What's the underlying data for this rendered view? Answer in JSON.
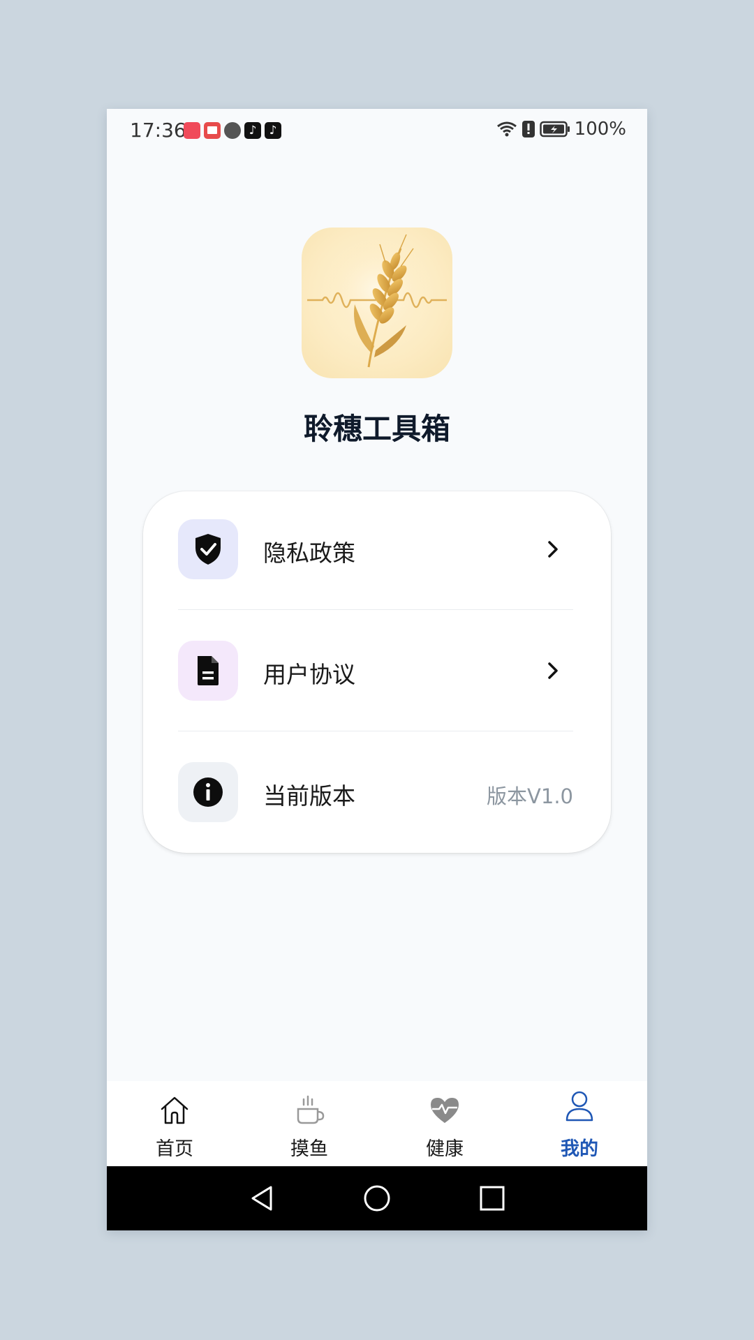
{
  "status_bar": {
    "time": "17:36",
    "battery": "100%",
    "notification_icons": [
      "app-notification-icon",
      "reader-notification-icon",
      "browser-notification-icon",
      "tiktok-notification-icon",
      "tiktok-notification-icon"
    ]
  },
  "app": {
    "name": "聆穗工具箱",
    "logo_icon": "wheat-sound-wave-logo"
  },
  "menu": {
    "items": [
      {
        "label": "隐私政策",
        "icon": "shield-check-icon",
        "icon_bg": "#e6e8fb",
        "has_chevron": true
      },
      {
        "label": "用户协议",
        "icon": "document-icon",
        "icon_bg": "#f4e8fb",
        "has_chevron": true
      },
      {
        "label": "当前版本",
        "icon": "info-icon",
        "icon_bg": "#eef1f5",
        "value": "版本V1.0"
      }
    ]
  },
  "bottom_nav": {
    "tabs": [
      {
        "label": "首页",
        "icon": "home-icon",
        "active": false
      },
      {
        "label": "摸鱼",
        "icon": "coffee-cup-icon",
        "active": false
      },
      {
        "label": "健康",
        "icon": "heart-pulse-icon",
        "active": false
      },
      {
        "label": "我的",
        "icon": "user-icon",
        "active": true
      }
    ],
    "active_color": "#1f57b5"
  }
}
